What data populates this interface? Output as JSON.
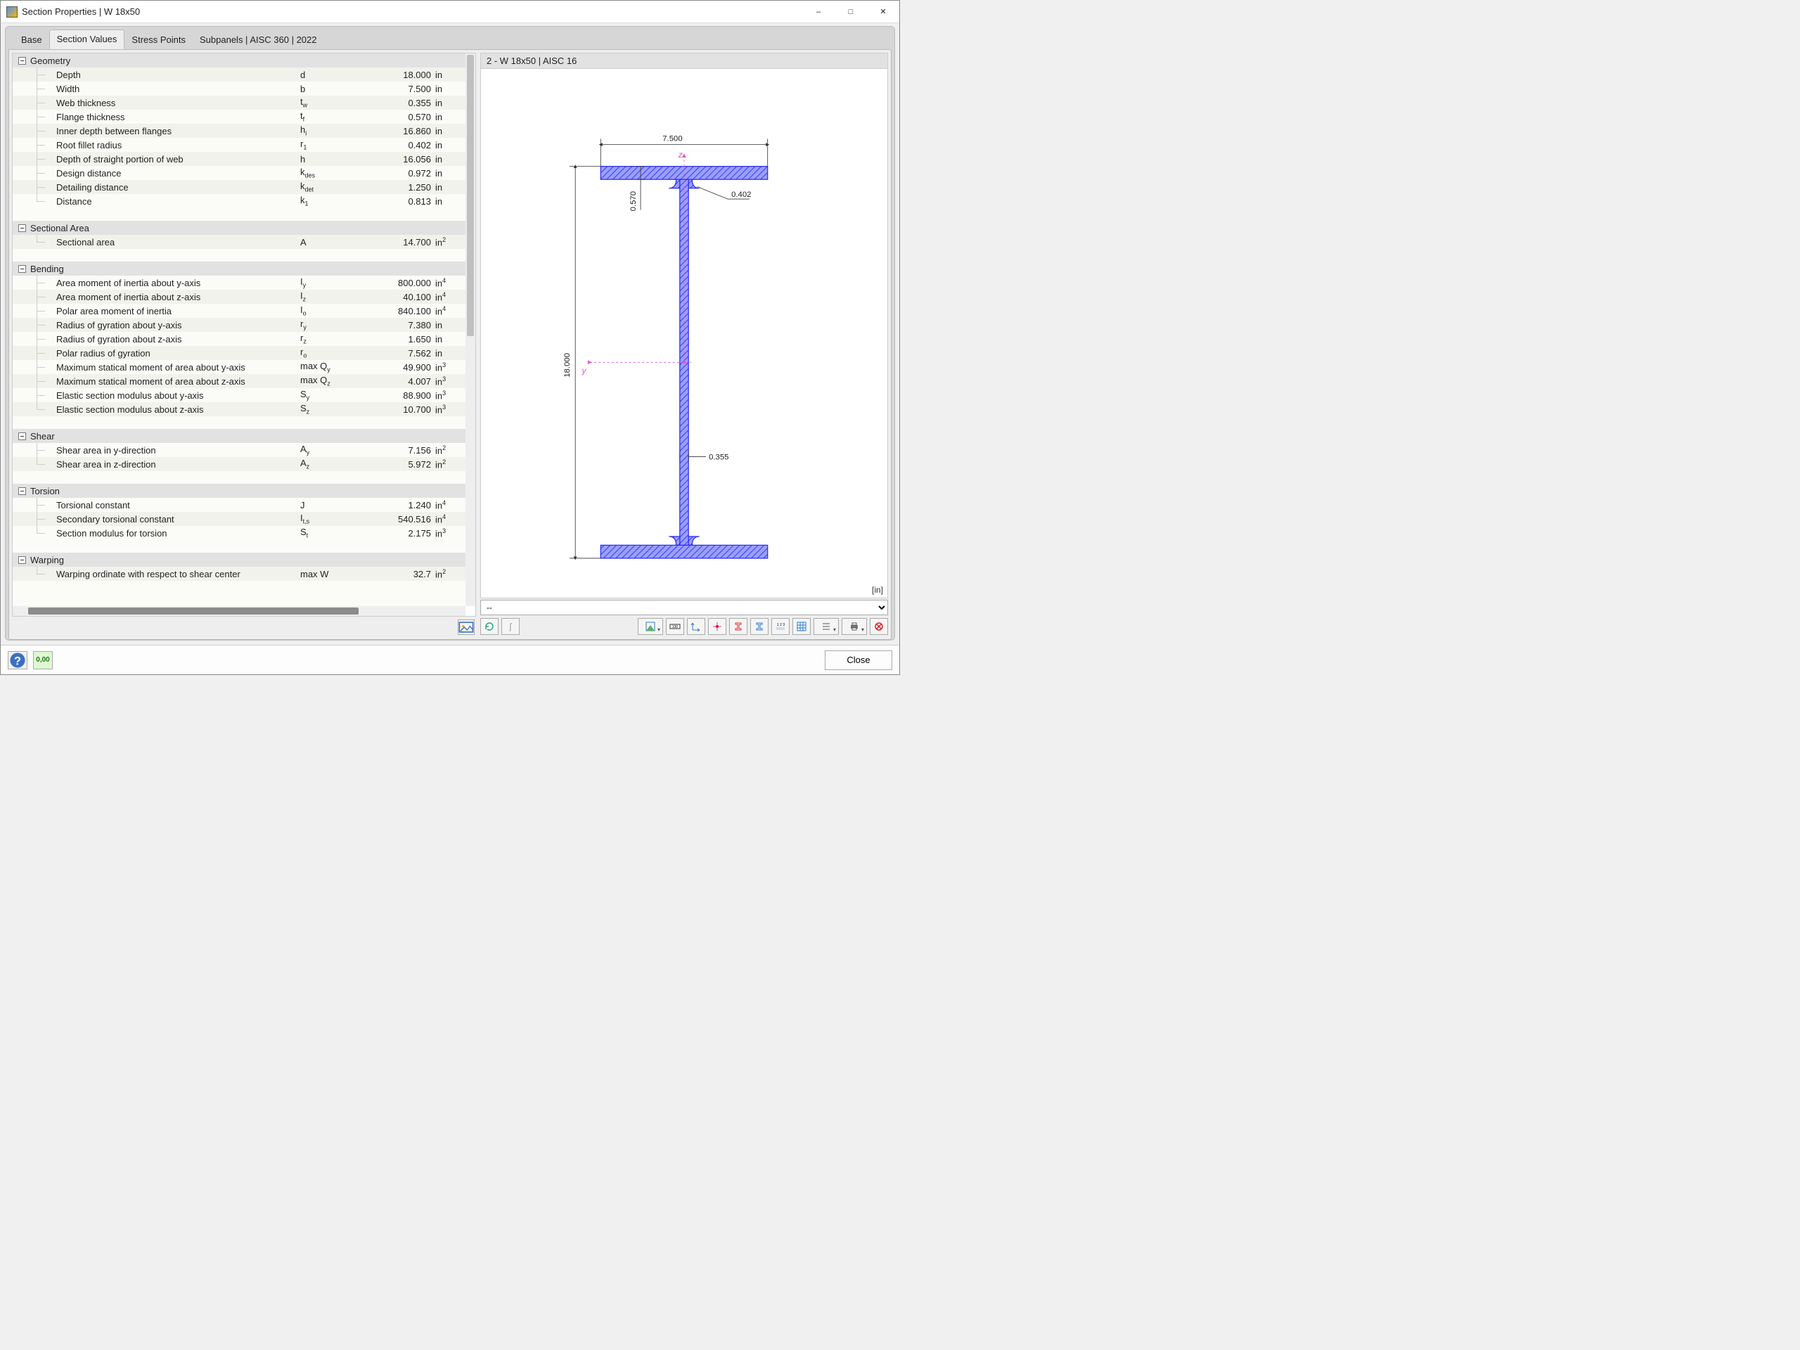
{
  "window": {
    "title": "Section Properties | W 18x50"
  },
  "tabs": [
    "Base",
    "Section Values",
    "Stress Points",
    "Subpanels | AISC 360 | 2022"
  ],
  "active_tab_index": 1,
  "right": {
    "header": "2 - W 18x50 | AISC 16",
    "unit_label": "[in]",
    "combo_value": "--"
  },
  "diagram": {
    "depth": "18.000",
    "width": "7.500",
    "tf": "0.570",
    "tw": "0.355",
    "r1": "0.402",
    "y_axis": "y",
    "z_axis": "z"
  },
  "groups": [
    {
      "title": "Geometry",
      "rows": [
        {
          "name": "Depth",
          "sym": "d",
          "val": "18.000",
          "unit": "in"
        },
        {
          "name": "Width",
          "sym": "b",
          "val": "7.500",
          "unit": "in"
        },
        {
          "name": "Web thickness",
          "sym": "t<sub>w</sub>",
          "val": "0.355",
          "unit": "in"
        },
        {
          "name": "Flange thickness",
          "sym": "t<sub>f</sub>",
          "val": "0.570",
          "unit": "in"
        },
        {
          "name": "Inner depth between flanges",
          "sym": "h<sub>i</sub>",
          "val": "16.860",
          "unit": "in"
        },
        {
          "name": "Root fillet radius",
          "sym": "r<sub>1</sub>",
          "val": "0.402",
          "unit": "in"
        },
        {
          "name": "Depth of straight portion of web",
          "sym": "h",
          "val": "16.056",
          "unit": "in"
        },
        {
          "name": "Design distance",
          "sym": "k<sub>des</sub>",
          "val": "0.972",
          "unit": "in"
        },
        {
          "name": "Detailing distance",
          "sym": "k<sub>det</sub>",
          "val": "1.250",
          "unit": "in"
        },
        {
          "name": "Distance",
          "sym": "k<sub>1</sub>",
          "val": "0.813",
          "unit": "in"
        }
      ]
    },
    {
      "title": "Sectional Area",
      "rows": [
        {
          "name": "Sectional area",
          "sym": "A",
          "val": "14.700",
          "unit": "in<sup>2</sup>"
        }
      ]
    },
    {
      "title": "Bending",
      "rows": [
        {
          "name": "Area moment of inertia about y-axis",
          "sym": "I<sub>y</sub>",
          "val": "800.000",
          "unit": "in<sup>4</sup>"
        },
        {
          "name": "Area moment of inertia about z-axis",
          "sym": "I<sub>z</sub>",
          "val": "40.100",
          "unit": "in<sup>4</sup>"
        },
        {
          "name": "Polar area moment of inertia",
          "sym": "I<sub>o</sub>",
          "val": "840.100",
          "unit": "in<sup>4</sup>"
        },
        {
          "name": "Radius of gyration about y-axis",
          "sym": "r<sub>y</sub>",
          "val": "7.380",
          "unit": "in"
        },
        {
          "name": "Radius of gyration about z-axis",
          "sym": "r<sub>z</sub>",
          "val": "1.650",
          "unit": "in"
        },
        {
          "name": "Polar radius of gyration",
          "sym": "r<sub>o</sub>",
          "val": "7.562",
          "unit": "in"
        },
        {
          "name": "Maximum statical moment of area about y-axis",
          "sym": "max Q<sub>y</sub>",
          "val": "49.900",
          "unit": "in<sup>3</sup>"
        },
        {
          "name": "Maximum statical moment of area about z-axis",
          "sym": "max Q<sub>z</sub>",
          "val": "4.007",
          "unit": "in<sup>3</sup>"
        },
        {
          "name": "Elastic section modulus about y-axis",
          "sym": "S<sub>y</sub>",
          "val": "88.900",
          "unit": "in<sup>3</sup>"
        },
        {
          "name": "Elastic section modulus about z-axis",
          "sym": "S<sub>z</sub>",
          "val": "10.700",
          "unit": "in<sup>3</sup>"
        }
      ]
    },
    {
      "title": "Shear",
      "rows": [
        {
          "name": "Shear area in y-direction",
          "sym": "A<sub>y</sub>",
          "val": "7.156",
          "unit": "in<sup>2</sup>"
        },
        {
          "name": "Shear area in z-direction",
          "sym": "A<sub>z</sub>",
          "val": "5.972",
          "unit": "in<sup>2</sup>"
        }
      ]
    },
    {
      "title": "Torsion",
      "rows": [
        {
          "name": "Torsional constant",
          "sym": "J",
          "val": "1.240",
          "unit": "in<sup>4</sup>"
        },
        {
          "name": "Secondary torsional constant",
          "sym": "I<sub>t,s</sub>",
          "val": "540.516",
          "unit": "in<sup>4</sup>"
        },
        {
          "name": "Section modulus for torsion",
          "sym": "S<sub>t</sub>",
          "val": "2.175",
          "unit": "in<sup>3</sup>"
        }
      ]
    },
    {
      "title": "Warping",
      "rows": [
        {
          "name": "Warping ordinate with respect to shear center",
          "sym": "max W",
          "val": "32.7",
          "unit": "in<sup>2</sup>"
        }
      ]
    }
  ],
  "footer": {
    "close": "Close"
  }
}
